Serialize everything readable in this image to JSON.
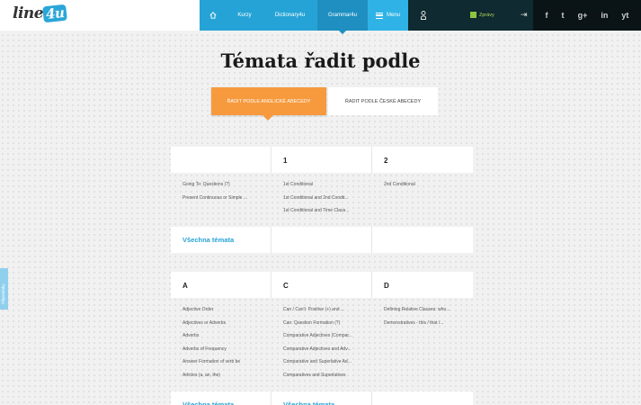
{
  "logo": {
    "text": "line",
    "badge": "4u"
  },
  "nav": {
    "home_icon": "home-icon",
    "kurzy": "Kurzy",
    "dictionary": "Dictionary4u",
    "grammar": "Grammar4u",
    "menu": "Menu",
    "news": "Zprávy"
  },
  "social": [
    "f",
    "t",
    "g+",
    "in",
    "yt"
  ],
  "page_title": "Témata řadit podle",
  "sort": {
    "english": "ŘADIT PODLE ANGLICKÉ ABECEDY",
    "czech": "ŘADIT PODLE ČESKÉ ABECEDY"
  },
  "tables": [
    {
      "headers": [
        "",
        "1",
        "2"
      ],
      "columns": [
        [
          "Going To: Questions (?)",
          "Present Continuous or Simple ..."
        ],
        [
          "1st Conditional",
          "1st Conditional and 2nd Condit...",
          "1st Conditional and Time Claus..."
        ],
        [
          "2nd Conditional"
        ]
      ],
      "footers": [
        "Všechna témata",
        "",
        ""
      ]
    },
    {
      "headers": [
        "A",
        "C",
        "D"
      ],
      "columns": [
        [
          "Adjective Order",
          "Adjectives or Adverbs",
          "Adverbs",
          "Adverbs of Frequency",
          "Answer Formation of verb be",
          "Articles (a, an, the)"
        ],
        [
          "Can / Can't: Positive (+) and ...",
          "Can: Question Formation (?)",
          "Comparative Adjectives (Compar...",
          "Comparative Adjectives and Adv...",
          "Comparative and Superlative Ad...",
          "Comparatives and Superlatives"
        ],
        [
          "Defining Relative Clauses: who...",
          "Demonstratives - this / that /..."
        ]
      ],
      "footers": [
        "Všechna témata",
        "Všechna témata",
        ""
      ]
    }
  ],
  "feedback": "Připomínky",
  "colors": {
    "blue": "#26a3d6",
    "orange": "#f79a3e",
    "dark": "#0f2a30",
    "green": "#8ec63f"
  }
}
